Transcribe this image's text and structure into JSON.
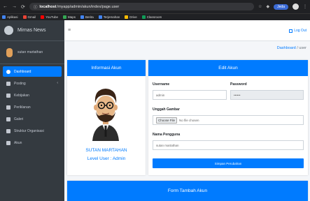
{
  "browser": {
    "url_host": "localhost",
    "url_rest": "/myapp/admin/akun/index/page.user",
    "paused_label": "Jeda",
    "bookmarks": [
      "Aplikasi",
      "Gmail",
      "YouTube",
      "Maps",
      "Berita",
      "Terjemahan",
      "Drive",
      "Classroom"
    ]
  },
  "sidebar": {
    "brand": "Mirnas News",
    "user": "sutan martathan",
    "items": [
      {
        "label": "Dashboard",
        "active": true
      },
      {
        "label": "Posting",
        "has_caret": true
      },
      {
        "label": "Kebijakan"
      },
      {
        "label": "Periklanan"
      },
      {
        "label": "Galeri"
      },
      {
        "label": "Struktur Organisasi"
      },
      {
        "label": "Akun"
      }
    ]
  },
  "navbar": {
    "logout": "Log Out"
  },
  "breadcrumb": {
    "home": "Dashboard",
    "separator": "/",
    "current": "user"
  },
  "profile_card": {
    "header": "Informasi Akun",
    "name": "SUTAN MARTAHAN",
    "level": "Level User : Admin"
  },
  "edit_card": {
    "header": "Edit Akun",
    "username_label": "Username",
    "username_value": "admin",
    "password_label": "Password",
    "password_value": "••••••",
    "upload_label": "Unggah Gambar",
    "file_button": "Choose File",
    "file_status": "No file chosen",
    "name_label": "Nama Pengguna",
    "name_value": "sutan martathan",
    "save_button": "Simpan Perubahan"
  },
  "add_card": {
    "header": "Form Tambah Akun"
  }
}
